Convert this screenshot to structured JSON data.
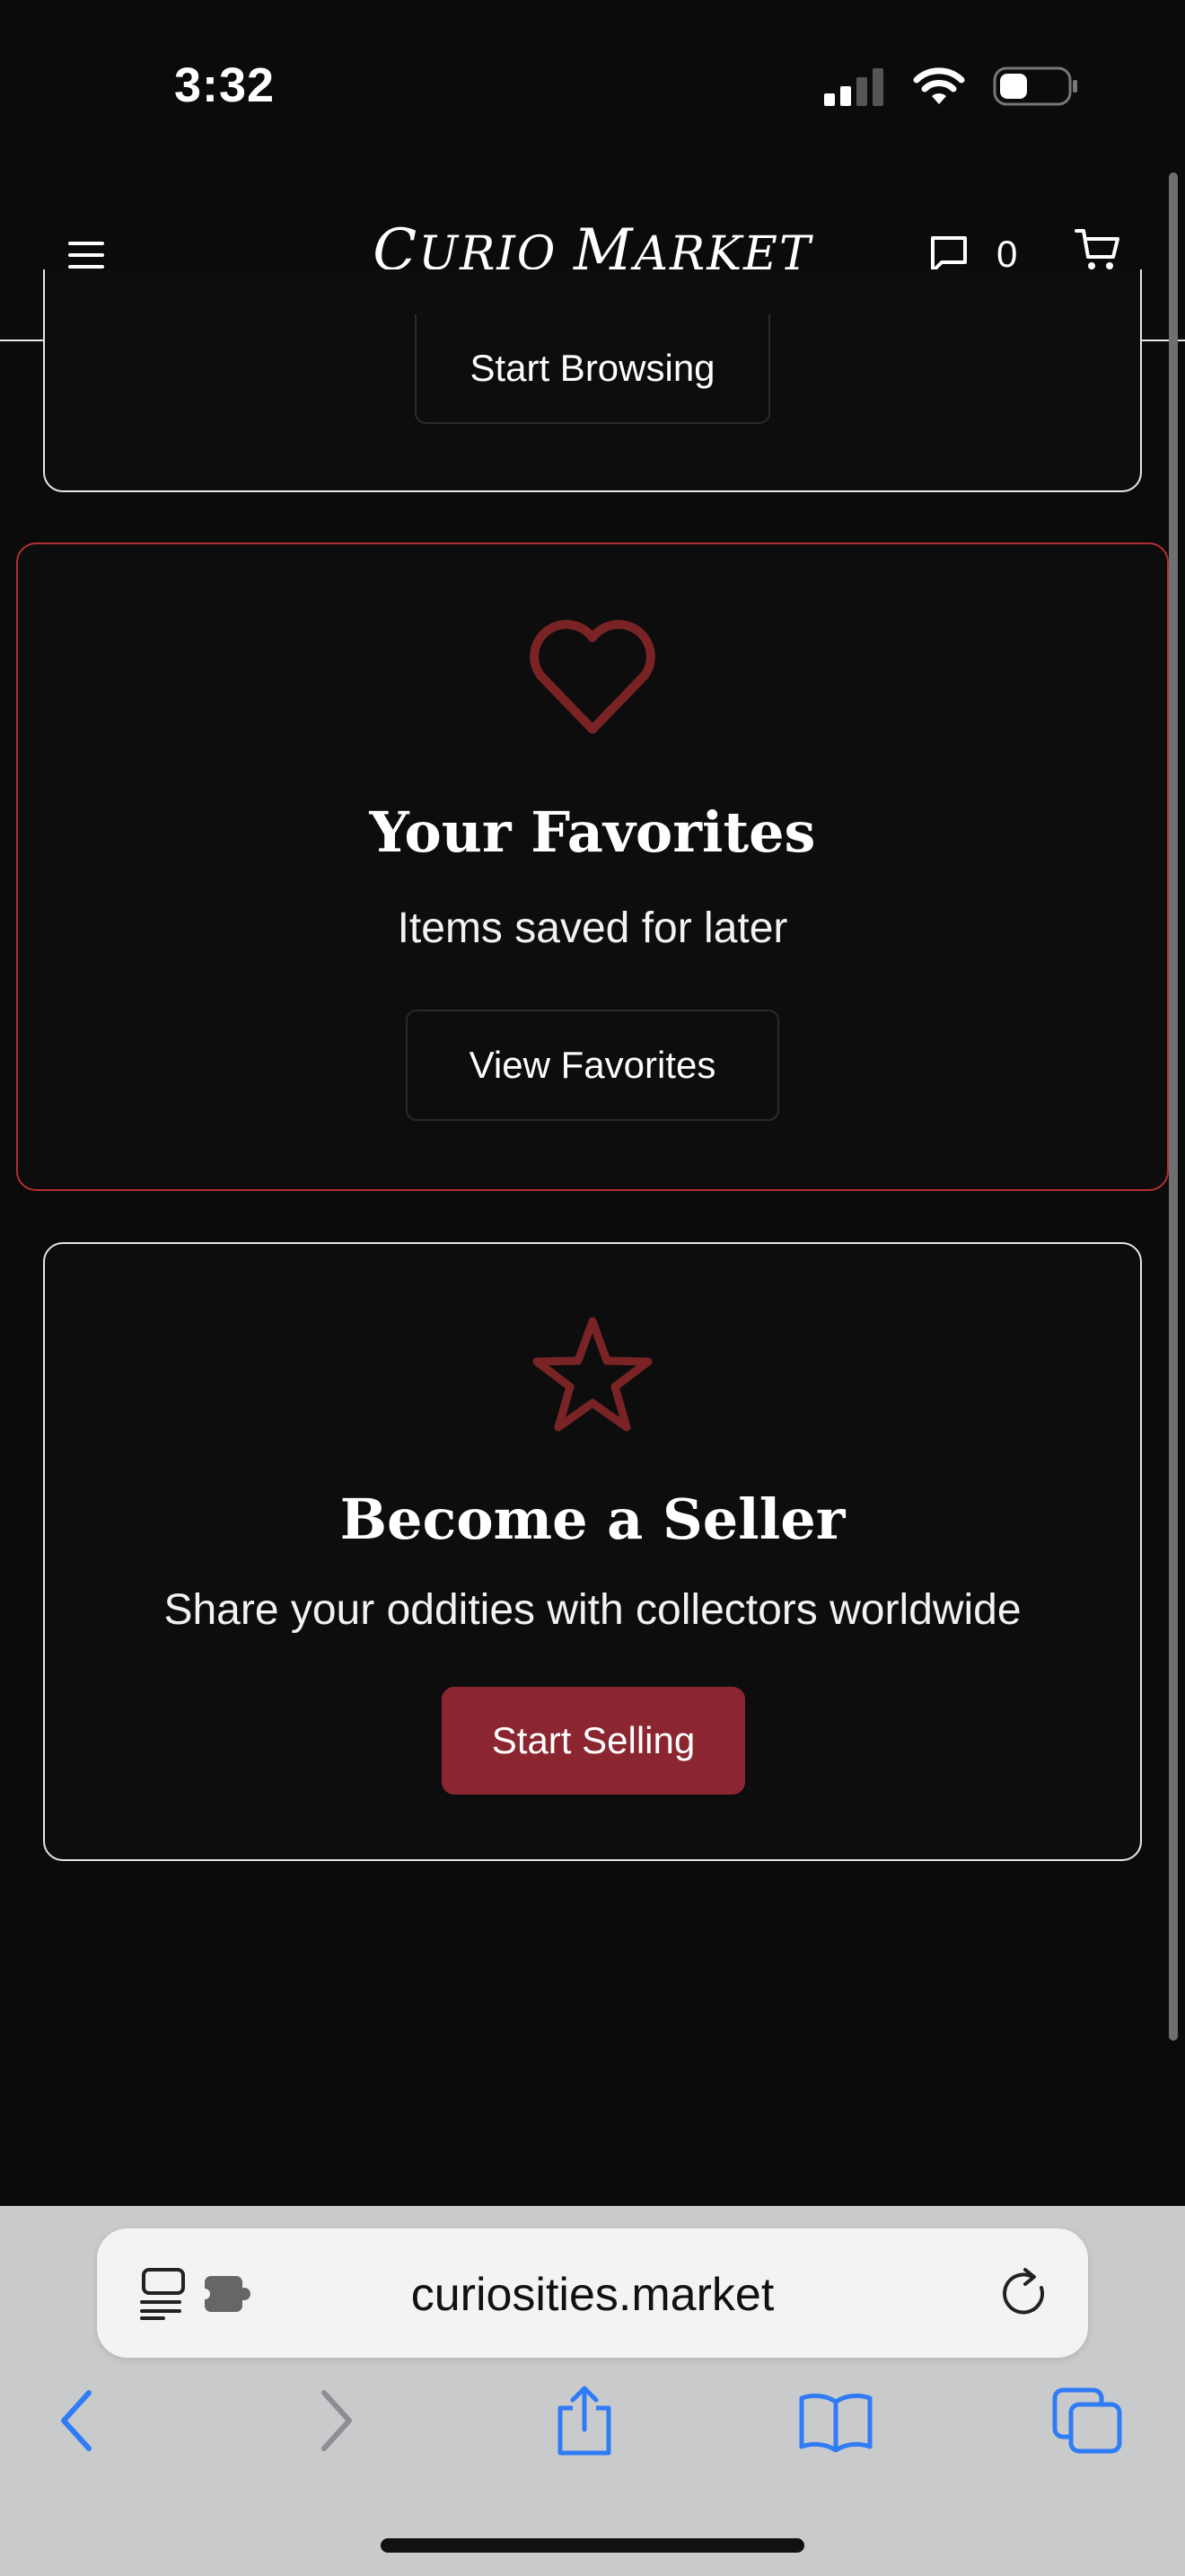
{
  "status_bar": {
    "time": "3:32"
  },
  "header": {
    "logo_first_initial": "C",
    "logo_first_rest": "URIO",
    "logo_second_initial": "M",
    "logo_second_rest": "ARKET",
    "messages_count": "0"
  },
  "browsing_card": {
    "button_label": "Start Browsing"
  },
  "favorites_card": {
    "icon": "heart-icon",
    "title": "Your Favorites",
    "subtitle": "Items saved for later",
    "button_label": "View Favorites"
  },
  "seller_card": {
    "icon": "star-icon",
    "title": "Become a Seller",
    "subtitle": "Share your oddities with collectors worldwide",
    "button_label": "Start Selling"
  },
  "browser": {
    "url": "curiosities.market",
    "icons": [
      "reader-icon",
      "extension-icon",
      "reload-icon",
      "back-icon",
      "forward-icon",
      "share-icon",
      "bookmarks-icon",
      "tabs-icon"
    ]
  },
  "colors": {
    "accent": "#8b2631",
    "icon_red": "#7a2325",
    "favorites_border": "#b32f2f",
    "background": "#0b0b0c",
    "safari_blue": "#2f7cf6"
  }
}
